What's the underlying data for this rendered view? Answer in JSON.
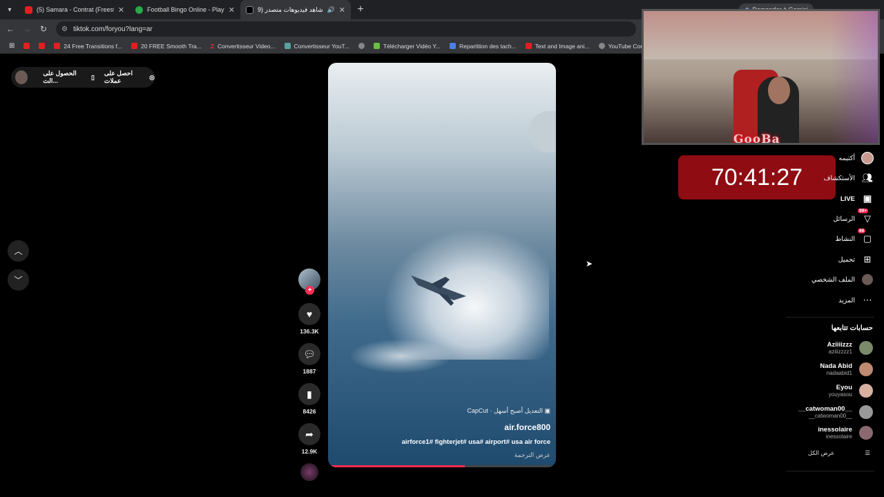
{
  "browser": {
    "tabs": [
      {
        "title": "(5) Samara - Contrat (Freestyle)",
        "favicon": "youtube-icon",
        "active": false
      },
      {
        "title": "Football Bingo Online - Play No",
        "favicon": "globe-icon",
        "active": false
      },
      {
        "title": "شاهد فيديوهات متصدر (99+)",
        "favicon": "tiktok-icon",
        "active": true
      }
    ],
    "gemini_label": "Demander à Gemini",
    "url": "tiktok.com/foryou?lang=ar",
    "bookmarks": [
      {
        "label": "",
        "icon": "youtube-icon"
      },
      {
        "label": "",
        "icon": "youtube-icon"
      },
      {
        "label": "24 Free Transitions f...",
        "icon": "youtube-icon"
      },
      {
        "label": "20 FREE Smooth Tra...",
        "icon": "youtube-icon"
      },
      {
        "label": "Convertisseur Video...",
        "icon": "z-icon"
      },
      {
        "label": "Convertisseur YouT...",
        "icon": "convert-icon"
      },
      {
        "label": "",
        "icon": "globe-icon"
      },
      {
        "label": "Télécharger Vidéo Y...",
        "icon": "download-icon"
      },
      {
        "label": "Repartition des tach...",
        "icon": "docs-icon"
      },
      {
        "label": "Text and Image ani...",
        "icon": "youtube-icon"
      },
      {
        "label": "YouTube Converter...",
        "icon": "globe-icon"
      }
    ]
  },
  "topbar": {
    "get_coins": "احصل على عملات",
    "get_app": "الحصول على الت..."
  },
  "video": {
    "capcut": "CapCut · التعديل أصبح أسهل",
    "author": "air.force800",
    "tags": "airforce1# fighterjet# usa# airport# usa air force",
    "translate": "عرض الترجمة",
    "progress": 0.6
  },
  "actions": {
    "likes": "136.3K",
    "comments": "1887",
    "saves": "8426",
    "shares": "12.9K"
  },
  "overlay": {
    "timer": "70:41:27",
    "streamer_logo": "GooBa"
  },
  "sidebar": {
    "items": [
      {
        "label": "أكتيمه",
        "icon": "avatar-icon"
      },
      {
        "label": "الأستكشاف",
        "icon": "friends-icon"
      },
      {
        "label": "LIVE",
        "icon": "live-icon"
      },
      {
        "label": "الرسائل",
        "icon": "messages-icon",
        "badge": "99+"
      },
      {
        "label": "النشاط",
        "icon": "activity-icon",
        "badge": "66"
      },
      {
        "label": "تحميل",
        "icon": "upload-icon"
      },
      {
        "label": "الملف الشخصي",
        "icon": "profile-icon"
      },
      {
        "label": "المزيد",
        "icon": "more-icon"
      }
    ],
    "following_title": "حسابات تتابعها",
    "accounts": [
      {
        "name": "Aziiiizzz",
        "username": "aziiizzzz1",
        "color": "#7a8a6a"
      },
      {
        "name": "Nada Abid",
        "username": "nadaabid1",
        "color": "#c08a70"
      },
      {
        "name": "Eyou",
        "username": "youyasou",
        "color": "#d8b0a0"
      },
      {
        "name": "__catwoman00__",
        "username": "__catwoman00__",
        "color": "#999999"
      },
      {
        "name": "inessolaire",
        "username": "inessolaire",
        "color": "#8a6a70"
      }
    ],
    "see_all": "عرض الكل"
  }
}
